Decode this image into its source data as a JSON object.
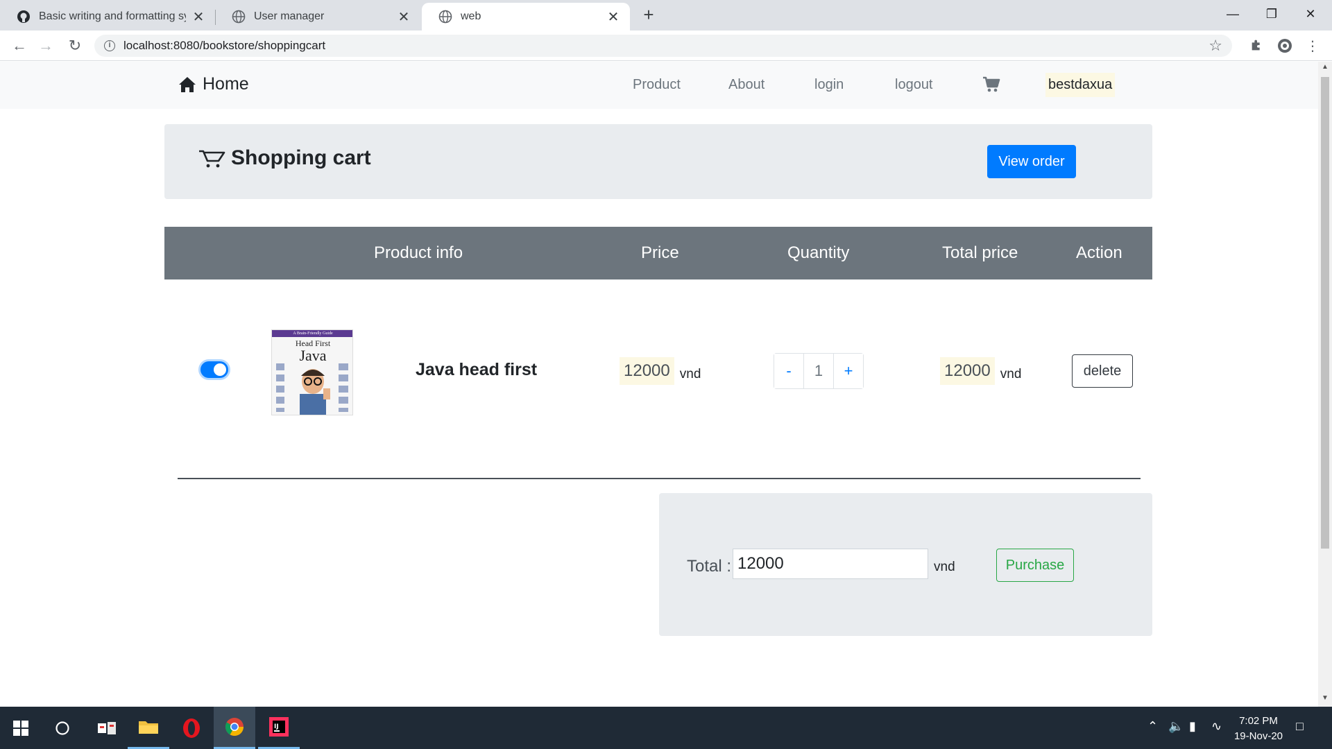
{
  "browser": {
    "tabs": [
      {
        "title": "Basic writing and formatting synt",
        "icon": "github-icon",
        "active": false
      },
      {
        "title": "User manager",
        "icon": "globe-icon",
        "active": false
      },
      {
        "title": "web",
        "icon": "globe-icon",
        "active": true
      }
    ],
    "close_glyph": "✕",
    "new_tab_glyph": "+",
    "url": "localhost:8080/bookstore/shoppingcart"
  },
  "navbar": {
    "brand": "Home",
    "links": [
      "Product",
      "About",
      "login",
      "logout"
    ],
    "user": "bestdaxua"
  },
  "cart_header": {
    "title": "Shopping cart",
    "view_order_label": "View order"
  },
  "table": {
    "headers": [
      "Product info",
      "Price",
      "Quantity",
      "Total price",
      "Action"
    ]
  },
  "item": {
    "selected": true,
    "cover": {
      "band": "A Brain-Friendly Guide",
      "line1": "Head First",
      "line2": "Java"
    },
    "name": "Java head first",
    "price": "12000",
    "price_unit": "vnd",
    "qty_minus": "-",
    "quantity": "1",
    "qty_plus": "+",
    "total": "12000",
    "total_unit": "vnd",
    "delete_label": "delete"
  },
  "summary": {
    "total_label": "Total :",
    "total_value": "12000",
    "unit": "vnd",
    "purchase_label": "Purchase"
  },
  "taskbar": {
    "time": "7:02 PM",
    "date": "19-Nov-20"
  },
  "colors": {
    "primary": "#007bff",
    "secondary": "#6c757d",
    "success": "#28a745",
    "highlight": "#fcf8e3",
    "panel": "#e9ecef"
  }
}
